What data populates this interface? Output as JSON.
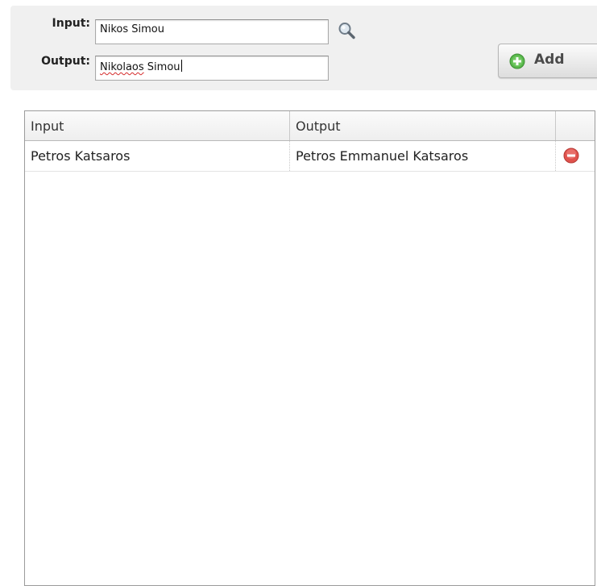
{
  "form": {
    "input_label": "Input:",
    "input_value": "Nikos Simou",
    "output_label": "Output:",
    "output_value_misspelled": "Nikolaos",
    "output_value_rest": " Simou",
    "add_label": "Add"
  },
  "icons": {
    "search": "magnifier-icon",
    "add": "green-plus-circle-icon",
    "remove": "red-minus-circle-icon"
  },
  "table": {
    "columns": [
      "Input",
      "Output",
      ""
    ],
    "rows": [
      {
        "input": "Petros Katsaros",
        "output": "Petros Emmanuel Katsaros"
      }
    ]
  },
  "colors": {
    "add_icon": "#4caf50",
    "remove_icon": "#e05050"
  }
}
